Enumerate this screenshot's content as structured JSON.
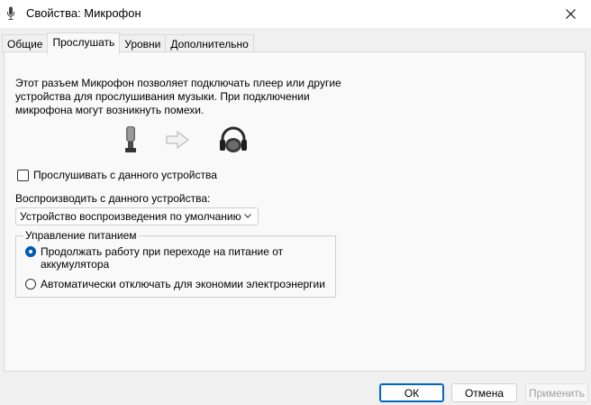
{
  "window": {
    "title": "Свойства: Микрофон",
    "icon": "microphone-icon"
  },
  "tabs": [
    {
      "label": "Общие",
      "active": false
    },
    {
      "label": "Прослушать",
      "active": true
    },
    {
      "label": "Уровни",
      "active": false
    },
    {
      "label": "Дополнительно",
      "active": false
    }
  ],
  "listen": {
    "description": [
      "Этот разъем Микрофон позволяет подключать плеер или другие",
      "устройства для прослушивания музыки. При подключении",
      "микрофона могут возникнуть помехи."
    ],
    "illustration_icons": [
      "microphone-icon",
      "arrow-right-icon",
      "headset-icon"
    ],
    "listen_checkbox_label": "Прослушивать с данного устройства",
    "listen_checkbox_checked": false,
    "playback_label": "Воспроизводить с данного устройства:",
    "playback_device_selected": "Устройство воспроизведения по умолчанию"
  },
  "power": {
    "group_title": "Управление питанием",
    "options": [
      {
        "label_lines": [
          "Продолжать работу при переходе на питание от",
          "аккумулятора"
        ],
        "selected": true
      },
      {
        "label_lines": [
          "Автоматически отключать для экономии электроэнергии"
        ],
        "selected": false
      }
    ]
  },
  "buttons": {
    "ok": "ОК",
    "cancel": "Отмена",
    "apply": "Применить",
    "apply_enabled": false
  },
  "colors": {
    "accent": "#0067c0",
    "radio_selected": "#0059b3",
    "disabled_text": "#a0a0a0"
  }
}
